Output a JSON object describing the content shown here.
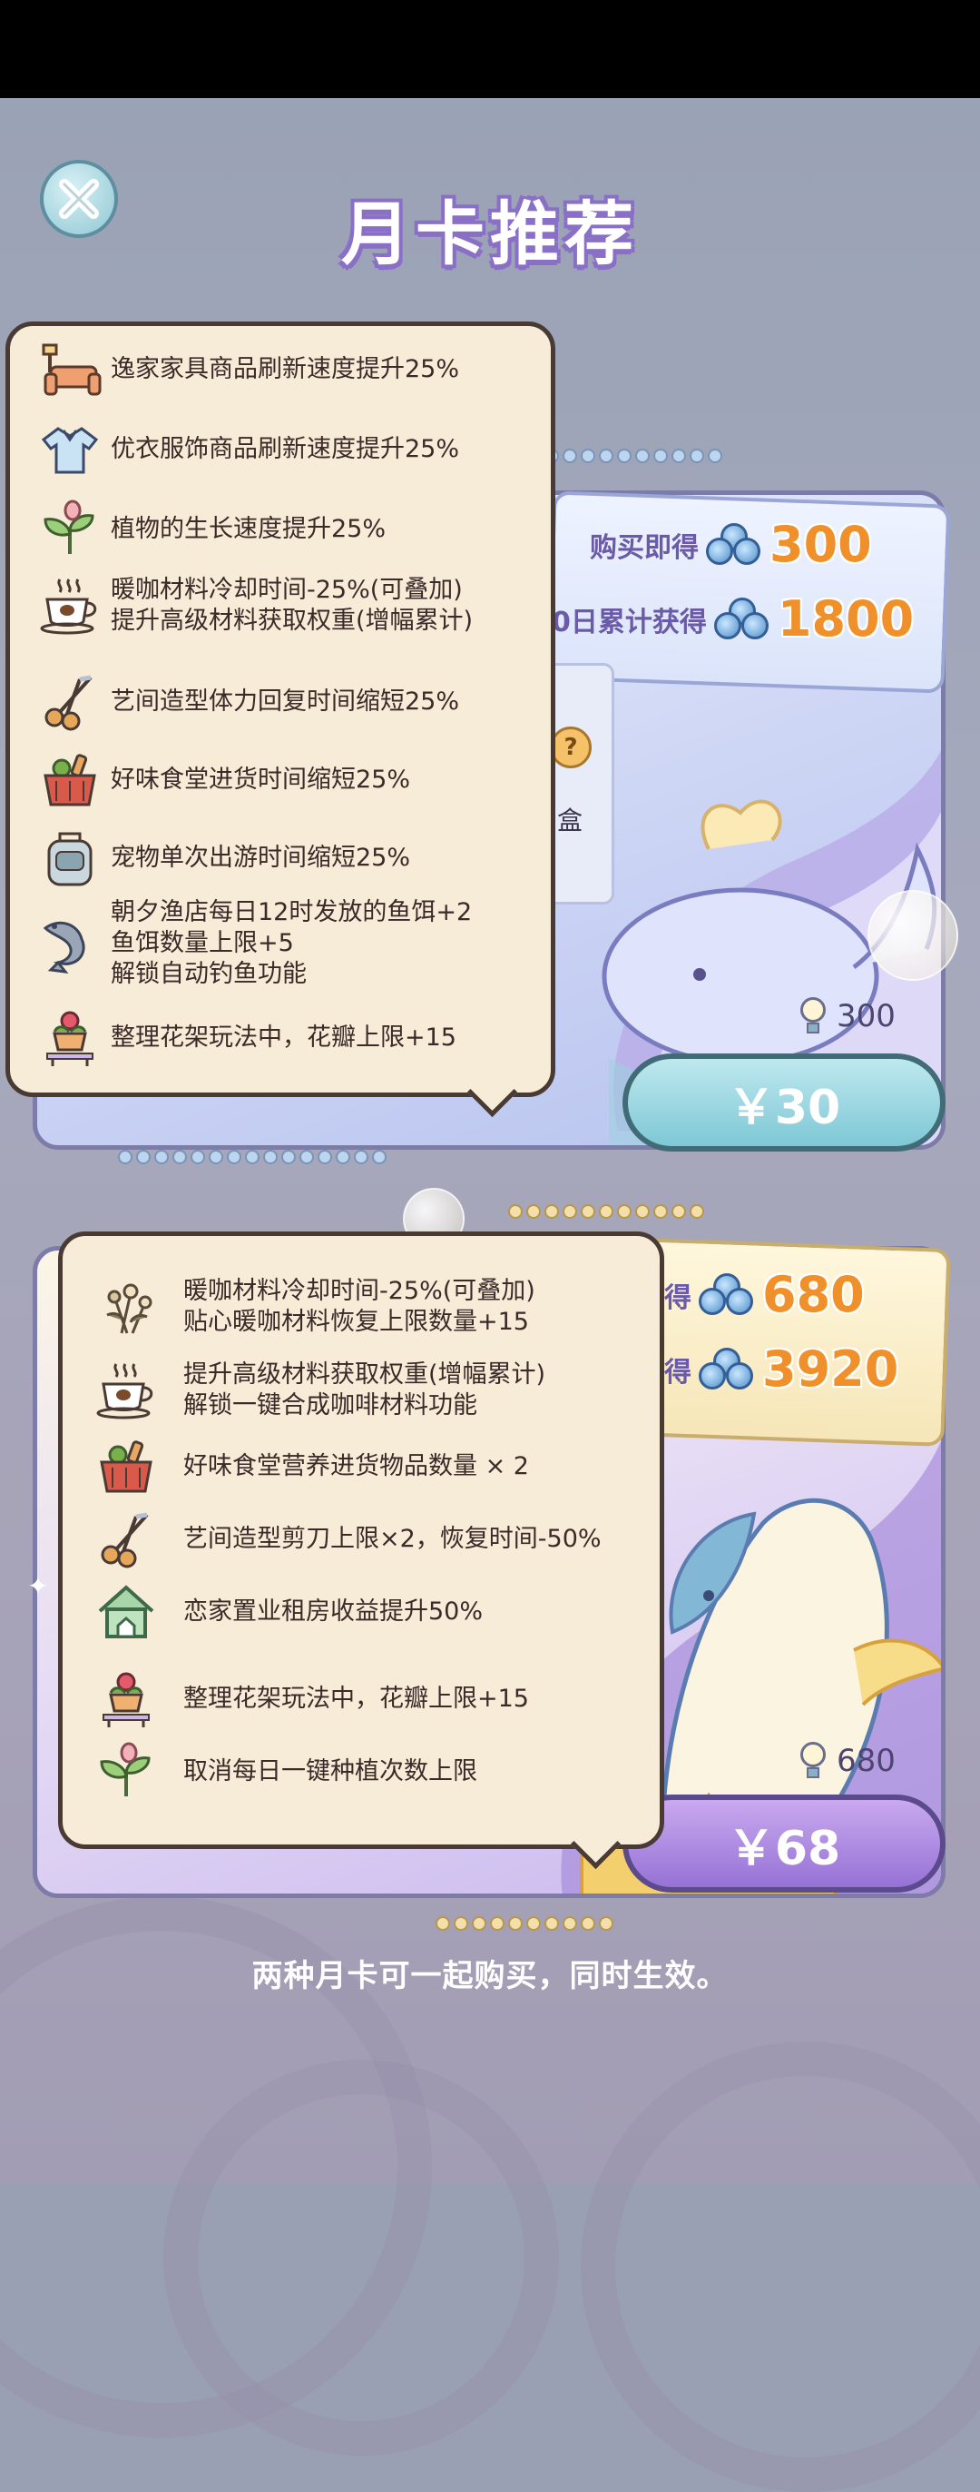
{
  "screen": {
    "title": "月卡推荐",
    "close_icon": "close-x-icon"
  },
  "card1": {
    "reward_buy_label": "购买即得",
    "reward_buy_value": "300",
    "reward_accum_label": "0日累计获得",
    "reward_accum_value": "1800",
    "partial_question_text": "?",
    "partial_box_text": "盒",
    "bulb_value": "300",
    "price": "￥30"
  },
  "card2": {
    "reward_buy_label": "得",
    "reward_buy_value": "680",
    "reward_accum_label": "得",
    "reward_accum_value": "3920",
    "bulb_value": "680",
    "price": "￥68"
  },
  "popup1": {
    "items": [
      {
        "icon": "furniture-icon",
        "lines": [
          "逸家家具商品刷新速度提升25%"
        ]
      },
      {
        "icon": "shirt-icon",
        "lines": [
          "优衣服饰商品刷新速度提升25%"
        ]
      },
      {
        "icon": "sprout-icon",
        "lines": [
          "植物的生长速度提升25%"
        ]
      },
      {
        "icon": "coffee-cup-icon",
        "lines": [
          "暖咖材料冷却时间-25%(可叠加)",
          "提升高级材料获取权重(增幅累计)"
        ]
      },
      {
        "icon": "scissors-icon",
        "lines": [
          "艺间造型体力回复时间缩短25%"
        ]
      },
      {
        "icon": "grocery-basket-icon",
        "lines": [
          "好味食堂进货时间缩短25%"
        ]
      },
      {
        "icon": "pet-carrier-icon",
        "lines": [
          "宠物单次出游时间缩短25%"
        ]
      },
      {
        "icon": "fish-icon",
        "lines": [
          "朝夕渔店每日12时发放的鱼饵+2",
          "鱼饵数量上限+5",
          "解锁自动钓鱼功能"
        ]
      },
      {
        "icon": "flower-pot-icon",
        "lines": [
          "整理花架玩法中，花瓣上限+15"
        ]
      }
    ]
  },
  "popup2": {
    "items": [
      {
        "icon": "dried-flowers-icon",
        "lines": [
          "暖咖材料冷却时间-25%(可叠加)",
          "贴心暖咖材料恢复上限数量+15"
        ]
      },
      {
        "icon": "coffee-cup-icon",
        "lines": [
          "提升高级材料获取权重(增幅累计)",
          "解锁一键合成咖啡材料功能"
        ]
      },
      {
        "icon": "grocery-basket-icon",
        "lines": [
          "好味食堂营养进货物品数量 × 2"
        ]
      },
      {
        "icon": "scissors-icon",
        "lines": [
          "艺间造型剪刀上限×2，恢复时间-50%"
        ]
      },
      {
        "icon": "house-icon",
        "lines": [
          "恋家置业租房收益提升50%"
        ]
      },
      {
        "icon": "flower-pot-icon",
        "lines": [
          "整理花架玩法中，花瓣上限+15"
        ]
      },
      {
        "icon": "sprout-icon",
        "lines": [
          "取消每日一键种植次数上限"
        ]
      }
    ]
  },
  "footer": "两种月卡可一起购买，同时生效。"
}
